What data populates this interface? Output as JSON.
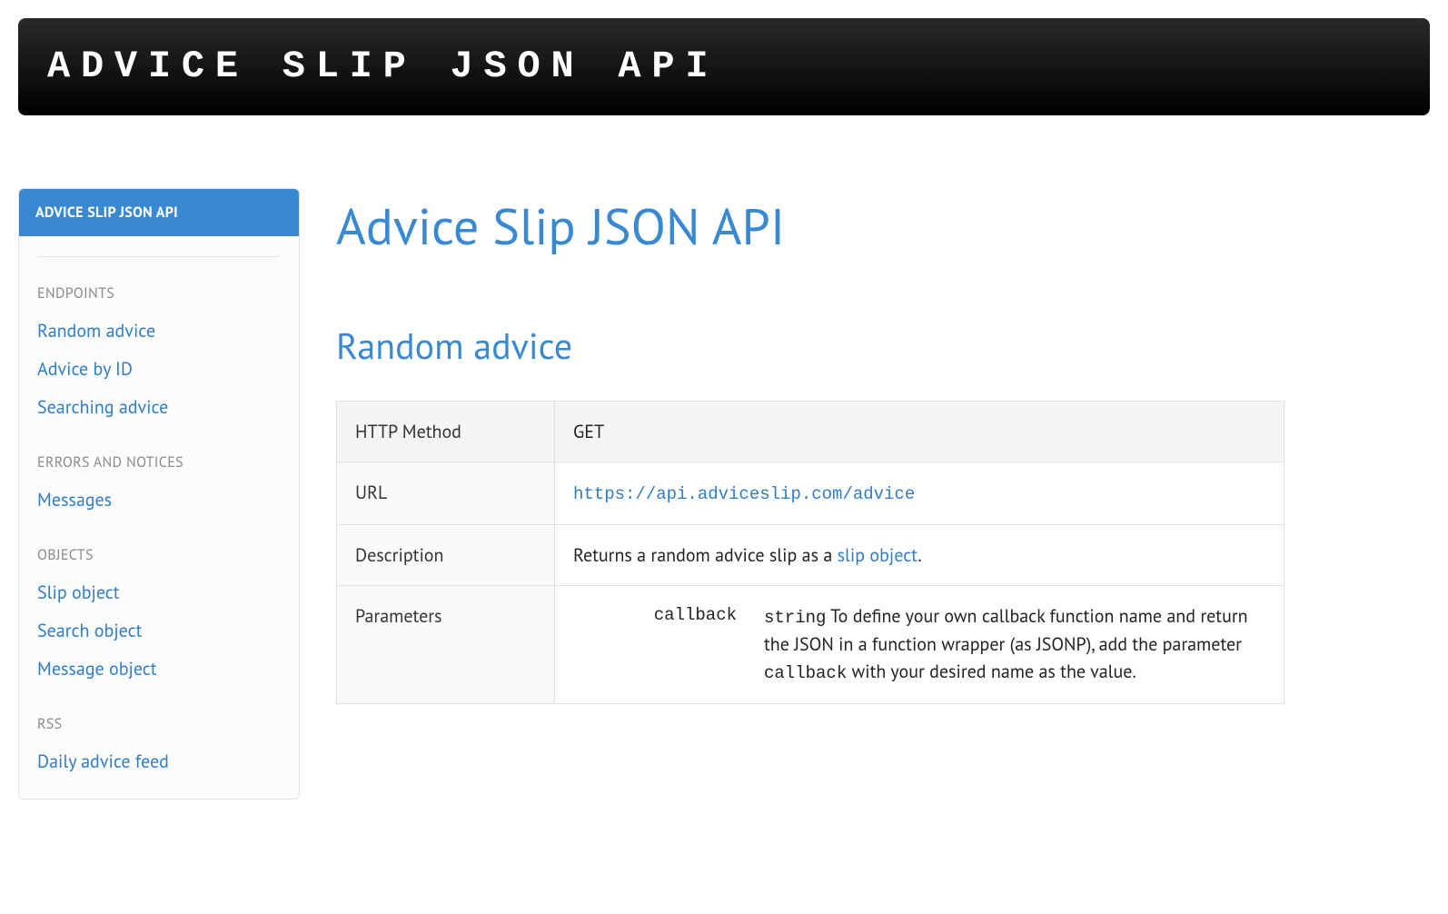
{
  "banner": {
    "title": "ADVICE SLIP JSON API"
  },
  "sidebar": {
    "active_title": "ADVICE SLIP JSON API",
    "groups": [
      {
        "label": "ENDPOINTS",
        "items": [
          "Random advice",
          "Advice by ID",
          "Searching advice"
        ]
      },
      {
        "label": "ERRORS AND NOTICES",
        "items": [
          "Messages"
        ]
      },
      {
        "label": "OBJECTS",
        "items": [
          "Slip object",
          "Search object",
          "Message object"
        ]
      },
      {
        "label": "RSS",
        "items": [
          "Daily advice feed"
        ]
      }
    ]
  },
  "main": {
    "page_title": "Advice Slip JSON API",
    "section_title": "Random advice",
    "rows": {
      "http_method": {
        "label": "HTTP Method",
        "value": "GET"
      },
      "url": {
        "label": "URL",
        "value": "https://api.adviceslip.com/advice"
      },
      "description": {
        "label": "Description",
        "prefix": "Returns a random advice slip as a ",
        "link_text": "slip object",
        "suffix": "."
      },
      "parameters": {
        "label": "Parameters",
        "param_name": "callback",
        "param_type": "string",
        "param_desc_1": " To define your own callback function name and return the JSON in a function wrapper (as JSONP), add the parameter ",
        "param_desc_code": "callback",
        "param_desc_2": " with your desired name as the value."
      }
    }
  }
}
